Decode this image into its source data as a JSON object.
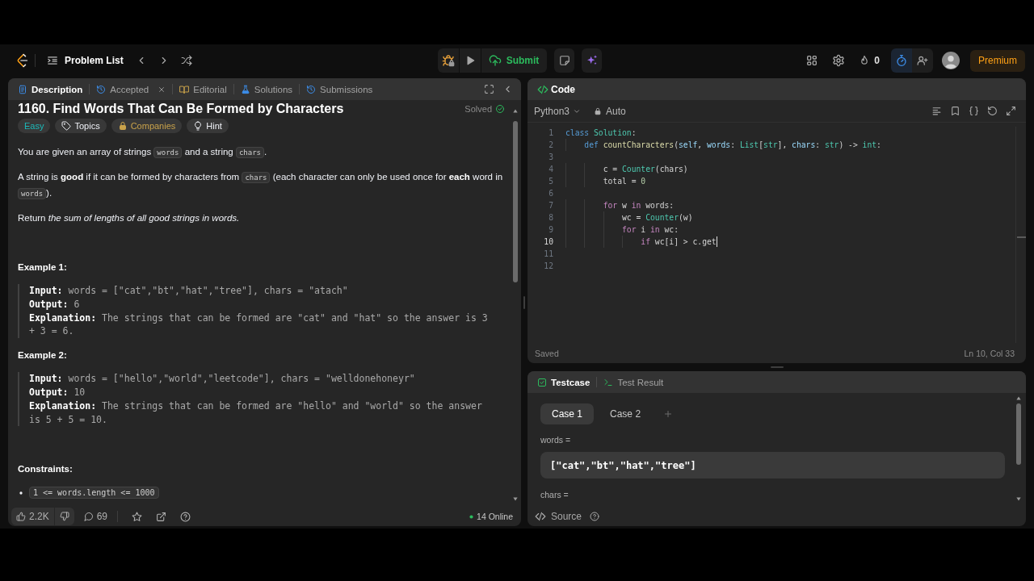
{
  "nav": {
    "problem_list": "Problem List",
    "submit": "Submit",
    "streak": "0",
    "premium": "Premium"
  },
  "description_panel": {
    "tabs": [
      {
        "label": "Description",
        "kind": "document",
        "selected": true,
        "closable": false
      },
      {
        "label": "Accepted",
        "kind": "history",
        "selected": false,
        "closable": true
      },
      {
        "label": "Editorial",
        "kind": "book",
        "selected": false,
        "closable": false
      },
      {
        "label": "Solutions",
        "kind": "flask",
        "selected": false,
        "closable": false
      },
      {
        "label": "Submissions",
        "kind": "history",
        "selected": false,
        "closable": false
      }
    ],
    "title": "1160. Find Words That Can Be Formed by Characters",
    "status": "Solved",
    "tags": [
      {
        "label": "Easy",
        "kind": "difficulty"
      },
      {
        "label": "Topics",
        "kind": "topics"
      },
      {
        "label": "Companies",
        "kind": "companies"
      },
      {
        "label": "Hint",
        "kind": "hint"
      }
    ],
    "paragraphs": [
      {
        "segments": [
          {
            "kind": "text",
            "text": "You are given an array of strings "
          },
          {
            "kind": "code",
            "text": "words"
          },
          {
            "kind": "text",
            "text": " and a string "
          },
          {
            "kind": "code",
            "text": "chars"
          },
          {
            "kind": "text",
            "text": "."
          }
        ]
      },
      {
        "segments": [
          {
            "kind": "text",
            "text": "A string is **good** if it can be formed by characters from "
          },
          {
            "kind": "code",
            "text": "chars"
          },
          {
            "kind": "text",
            "text": " (each character can only be used once for **each** word in "
          },
          {
            "kind": "code",
            "text": "words"
          },
          {
            "kind": "text",
            "text": ")."
          }
        ]
      },
      {
        "segments": [
          {
            "kind": "text",
            "text": "Return *the sum of lengths of all good strings in words.*"
          }
        ]
      }
    ],
    "examples": [
      {
        "title": "Example 1:",
        "lines": [
          "**Input:** words = [\"cat\",\"bt\",\"hat\",\"tree\"], chars = \"atach\"",
          "**Output:** 6",
          "**Explanation:** The strings that can be formed are \"cat\" and \"hat\" so the answer is 3 + 3 = 6."
        ]
      },
      {
        "title": "Example 2:",
        "lines": [
          "**Input:** words = [\"hello\",\"world\",\"leetcode\"], chars = \"welldonehoneyr\"",
          "**Output:** 10",
          "**Explanation:** The strings that can be formed are \"hello\" and \"world\" so the answer is 5 + 5 = 10."
        ]
      }
    ],
    "constraints_title": "Constraints:",
    "constraints": [
      "1 <= words.length <= 1000"
    ],
    "footer": {
      "likes": "2.2K",
      "comments": "69",
      "online": "14 Online"
    }
  },
  "code_panel": {
    "title": "Code",
    "language": "Python3",
    "mode": "Auto",
    "lines": [
      {
        "number": "1",
        "active": false,
        "tokens": [
          {
            "kind": "keyword",
            "text": "class "
          },
          {
            "kind": "type",
            "text": "Solution"
          },
          {
            "kind": "plain",
            "text": ":"
          }
        ]
      },
      {
        "number": "2",
        "active": false,
        "tokens": [
          {
            "kind": "keyword",
            "text": "    def "
          },
          {
            "kind": "function",
            "text": "countCharacters"
          },
          {
            "kind": "plain",
            "text": "("
          },
          {
            "kind": "param",
            "text": "self"
          },
          {
            "kind": "plain",
            "text": ", "
          },
          {
            "kind": "param",
            "text": "words"
          },
          {
            "kind": "plain",
            "text": ": "
          },
          {
            "kind": "type",
            "text": "List"
          },
          {
            "kind": "plain",
            "text": "["
          },
          {
            "kind": "type",
            "text": "str"
          },
          {
            "kind": "plain",
            "text": "], "
          },
          {
            "kind": "param",
            "text": "chars"
          },
          {
            "kind": "plain",
            "text": ": "
          },
          {
            "kind": "type",
            "text": "str"
          },
          {
            "kind": "plain",
            "text": ") -> "
          },
          {
            "kind": "type",
            "text": "int"
          },
          {
            "kind": "plain",
            "text": ":"
          }
        ]
      },
      {
        "number": "3",
        "active": false
      },
      {
        "number": "4",
        "active": false,
        "tokens": [
          {
            "kind": "variable",
            "text": "        c"
          },
          {
            "kind": "plain",
            "text": " = "
          },
          {
            "kind": "type",
            "text": "Counter"
          },
          {
            "kind": "plain",
            "text": "("
          },
          {
            "kind": "variable",
            "text": "chars"
          },
          {
            "kind": "plain",
            "text": ")"
          }
        ]
      },
      {
        "number": "5",
        "active": false,
        "tokens": [
          {
            "kind": "variable",
            "text": "        total"
          },
          {
            "kind": "plain",
            "text": " = "
          },
          {
            "kind": "number",
            "text": "0"
          }
        ]
      },
      {
        "number": "6",
        "active": false
      },
      {
        "number": "7",
        "active": false,
        "tokens": [
          {
            "kind": "control",
            "text": "        for "
          },
          {
            "kind": "variable",
            "text": "w "
          },
          {
            "kind": "control",
            "text": "in "
          },
          {
            "kind": "variable",
            "text": "words"
          },
          {
            "kind": "plain",
            "text": ":"
          }
        ]
      },
      {
        "number": "8",
        "active": false,
        "tokens": [
          {
            "kind": "variable",
            "text": "            wc"
          },
          {
            "kind": "plain",
            "text": " = "
          },
          {
            "kind": "type",
            "text": "Counter"
          },
          {
            "kind": "plain",
            "text": "("
          },
          {
            "kind": "variable",
            "text": "w"
          },
          {
            "kind": "plain",
            "text": ")"
          }
        ]
      },
      {
        "number": "9",
        "active": false,
        "tokens": [
          {
            "kind": "control",
            "text": "            for "
          },
          {
            "kind": "variable",
            "text": "i "
          },
          {
            "kind": "control",
            "text": "in "
          },
          {
            "kind": "variable",
            "text": "wc"
          },
          {
            "kind": "plain",
            "text": ":"
          }
        ]
      },
      {
        "number": "10",
        "active": true,
        "tokens": [
          {
            "kind": "control",
            "text": "                if "
          },
          {
            "kind": "variable",
            "text": "wc"
          },
          {
            "kind": "plain",
            "text": "["
          },
          {
            "kind": "variable",
            "text": "i"
          },
          {
            "kind": "plain",
            "text": "] > "
          },
          {
            "kind": "variable",
            "text": "c"
          },
          {
            "kind": "plain",
            "text": "."
          },
          {
            "kind": "variable",
            "text": "get"
          }
        ]
      },
      {
        "number": "11",
        "active": false
      },
      {
        "number": "12",
        "active": false
      }
    ],
    "status": "Saved",
    "position": "Ln 10, Col 33"
  },
  "testcase_panel": {
    "tabs": [
      {
        "label": "Testcase",
        "kind": "checkbox",
        "selected": true
      },
      {
        "label": "Test Result",
        "kind": "terminal",
        "selected": false
      }
    ],
    "cases": [
      {
        "label": "Case 1",
        "selected": true
      },
      {
        "label": "Case 2",
        "selected": false
      }
    ],
    "params": [
      {
        "name": "words =",
        "value": "[\"cat\",\"bt\",\"hat\",\"tree\"]"
      },
      {
        "name": "chars ="
      }
    ],
    "source": "Source"
  }
}
